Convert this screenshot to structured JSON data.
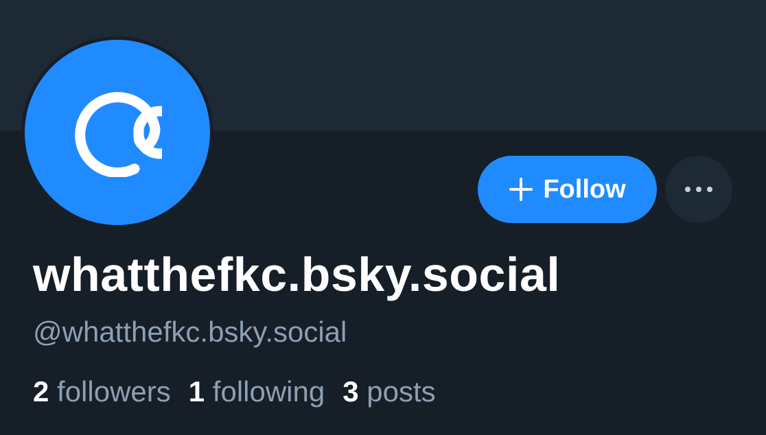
{
  "profile": {
    "display_name": "whatthefkc.bsky.social",
    "handle": "@whatthefkc.bsky.social",
    "avatar_icon": "at-sign-icon"
  },
  "actions": {
    "follow_label": "Follow",
    "more_icon": "ellipsis-icon"
  },
  "stats": {
    "followers_count": "2",
    "followers_label": "followers",
    "following_count": "1",
    "following_label": "following",
    "posts_count": "3",
    "posts_label": "posts"
  },
  "colors": {
    "background": "#161e27",
    "banner": "#1e2936",
    "accent": "#208bfe",
    "secondary_text": "#8d9fb4"
  }
}
